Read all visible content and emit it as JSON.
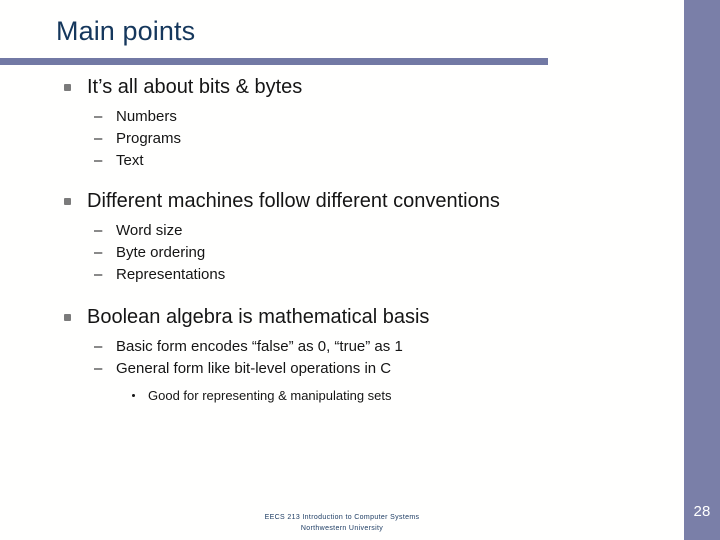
{
  "slide": {
    "title": "Main points",
    "page_number": "28",
    "accent_rule_color": "#7279a4",
    "title_color": "#15375c",
    "side_band_color": "#7a7fa8",
    "body_text_color": "#151515",
    "footer_color": "#1d3c63",
    "background_color": "#ffffff"
  },
  "bullets": [
    {
      "text": "It’s all about bits & bytes",
      "marker": "square-bullet",
      "sub": [
        {
          "text": "Numbers",
          "marker": "en-dash-bullet"
        },
        {
          "text": "Programs",
          "marker": "en-dash-bullet"
        },
        {
          "text": "Text",
          "marker": "en-dash-bullet"
        }
      ]
    },
    {
      "text": "Different machines follow different conventions",
      "marker": "square-bullet",
      "sub": [
        {
          "text": "Word size",
          "marker": "en-dash-bullet"
        },
        {
          "text": "Byte ordering",
          "marker": "en-dash-bullet"
        },
        {
          "text": "Representations",
          "marker": "en-dash-bullet"
        }
      ]
    },
    {
      "text": "Boolean algebra is mathematical basis",
      "marker": "square-bullet",
      "sub": [
        {
          "text": "Basic form encodes “false” as 0, “true” as 1",
          "marker": "en-dash-bullet"
        },
        {
          "text": "General form like bit-level operations in C",
          "marker": "en-dash-bullet"
        }
      ],
      "sub_sub": [
        {
          "text": "Good for representing & manipulating sets",
          "marker": "dot-bullet"
        }
      ]
    }
  ],
  "markers": {
    "dash": "–"
  },
  "footer": {
    "line1": "EECS 213 Introduction to Computer Systems",
    "line2": "Northwestern University"
  }
}
